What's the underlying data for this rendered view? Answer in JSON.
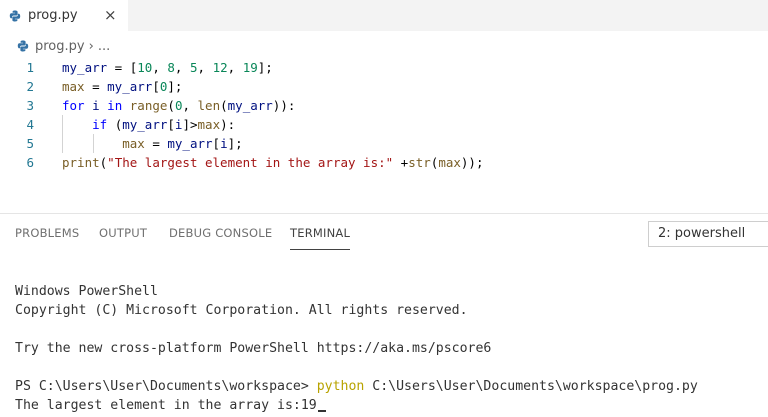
{
  "tab": {
    "filename": "prog.py",
    "close_glyph": "×",
    "icon": "python-file-icon"
  },
  "breadcrumb": {
    "file": "prog.py",
    "separator": "›",
    "more": "..."
  },
  "editor": {
    "line_numbers": [
      "1",
      "2",
      "3",
      "4",
      "5",
      "6"
    ],
    "lines": [
      [
        {
          "t": "my_arr",
          "c": "id"
        },
        {
          "t": " = [",
          "c": "pl"
        },
        {
          "t": "10",
          "c": "num"
        },
        {
          "t": ", ",
          "c": "pl"
        },
        {
          "t": "8",
          "c": "num"
        },
        {
          "t": ", ",
          "c": "pl"
        },
        {
          "t": "5",
          "c": "num"
        },
        {
          "t": ", ",
          "c": "pl"
        },
        {
          "t": "12",
          "c": "num"
        },
        {
          "t": ", ",
          "c": "pl"
        },
        {
          "t": "19",
          "c": "num"
        },
        {
          "t": "];",
          "c": "pl"
        }
      ],
      [
        {
          "t": "max",
          "c": "fn"
        },
        {
          "t": " = ",
          "c": "pl"
        },
        {
          "t": "my_arr",
          "c": "id"
        },
        {
          "t": "[",
          "c": "pl"
        },
        {
          "t": "0",
          "c": "num"
        },
        {
          "t": "];",
          "c": "pl"
        }
      ],
      [
        {
          "t": "for",
          "c": "kw"
        },
        {
          "t": " ",
          "c": "pl"
        },
        {
          "t": "i",
          "c": "id"
        },
        {
          "t": " ",
          "c": "pl"
        },
        {
          "t": "in",
          "c": "kw"
        },
        {
          "t": " ",
          "c": "pl"
        },
        {
          "t": "range",
          "c": "fn"
        },
        {
          "t": "(",
          "c": "pl"
        },
        {
          "t": "0",
          "c": "num"
        },
        {
          "t": ", ",
          "c": "pl"
        },
        {
          "t": "len",
          "c": "fn"
        },
        {
          "t": "(",
          "c": "pl"
        },
        {
          "t": "my_arr",
          "c": "id"
        },
        {
          "t": ")):",
          "c": "pl"
        }
      ],
      [
        {
          "t": "    ",
          "c": "pl"
        },
        {
          "t": "if",
          "c": "kw"
        },
        {
          "t": " (",
          "c": "pl"
        },
        {
          "t": "my_arr",
          "c": "id"
        },
        {
          "t": "[",
          "c": "pl"
        },
        {
          "t": "i",
          "c": "id"
        },
        {
          "t": "]>",
          "c": "pl"
        },
        {
          "t": "max",
          "c": "fn"
        },
        {
          "t": "):",
          "c": "pl"
        }
      ],
      [
        {
          "t": "        ",
          "c": "pl"
        },
        {
          "t": "max",
          "c": "fn"
        },
        {
          "t": " = ",
          "c": "pl"
        },
        {
          "t": "my_arr",
          "c": "id"
        },
        {
          "t": "[",
          "c": "pl"
        },
        {
          "t": "i",
          "c": "id"
        },
        {
          "t": "];",
          "c": "pl"
        }
      ],
      [
        {
          "t": "print",
          "c": "fn"
        },
        {
          "t": "(",
          "c": "pl"
        },
        {
          "t": "\"The largest element in the array is:\"",
          "c": "str"
        },
        {
          "t": " +",
          "c": "pl"
        },
        {
          "t": "str",
          "c": "fn"
        },
        {
          "t": "(",
          "c": "pl"
        },
        {
          "t": "max",
          "c": "fn"
        },
        {
          "t": "));",
          "c": "pl"
        }
      ]
    ]
  },
  "panel": {
    "tabs": [
      "PROBLEMS",
      "OUTPUT",
      "DEBUG CONSOLE",
      "TERMINAL"
    ],
    "active_tab": "TERMINAL",
    "terminal_select": "2: powershell"
  },
  "terminal": {
    "line1": "Windows PowerShell",
    "line2": "Copyright (C) Microsoft Corporation. All rights reserved.",
    "line3": "Try the new cross-platform PowerShell https://aka.ms/pscore6",
    "prompt": "PS C:\\Users\\User\\Documents\\workspace> ",
    "command": "python",
    "command_arg": " C:\\Users\\User\\Documents\\workspace\\prog.py",
    "output": "The largest element in the array is:19"
  },
  "colors": {
    "keyword": "#0000ff",
    "number": "#098658",
    "string": "#a31515",
    "function": "#795e26",
    "identifier": "#001080",
    "line_number": "#237893",
    "terminal_command": "#b8a300"
  }
}
